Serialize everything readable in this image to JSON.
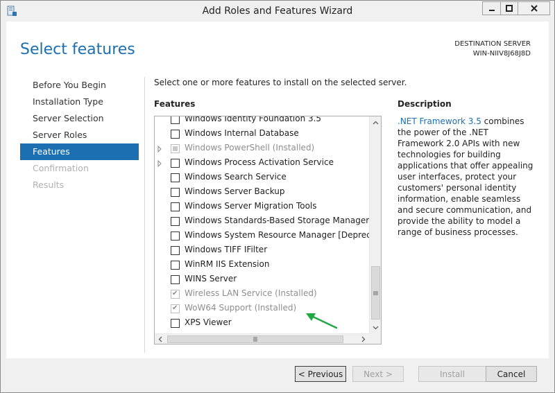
{
  "window": {
    "title": "Add Roles and Features Wizard"
  },
  "header": {
    "page_title": "Select features",
    "destination_label": "DESTINATION SERVER",
    "destination_server": "WIN-NIIV8J68J8D"
  },
  "nav": {
    "items": [
      {
        "label": "Before You Begin",
        "state": "normal"
      },
      {
        "label": "Installation Type",
        "state": "normal"
      },
      {
        "label": "Server Selection",
        "state": "normal"
      },
      {
        "label": "Server Roles",
        "state": "normal"
      },
      {
        "label": "Features",
        "state": "active"
      },
      {
        "label": "Confirmation",
        "state": "disabled"
      },
      {
        "label": "Results",
        "state": "disabled"
      }
    ]
  },
  "main": {
    "intro": "Select one or more features to install on the selected server.",
    "features_label": "Features",
    "features": [
      {
        "label": "Windows Identity Foundation 3.5",
        "checked": false,
        "disabled": false,
        "expandable": false
      },
      {
        "label": "Windows Internal Database",
        "checked": false,
        "disabled": false,
        "expandable": false
      },
      {
        "label": "Windows PowerShell (Installed)",
        "checked": "partial",
        "disabled": true,
        "expandable": true
      },
      {
        "label": "Windows Process Activation Service",
        "checked": false,
        "disabled": false,
        "expandable": true
      },
      {
        "label": "Windows Search Service",
        "checked": false,
        "disabled": false,
        "expandable": false
      },
      {
        "label": "Windows Server Backup",
        "checked": false,
        "disabled": false,
        "expandable": false
      },
      {
        "label": "Windows Server Migration Tools",
        "checked": false,
        "disabled": false,
        "expandable": false
      },
      {
        "label": "Windows Standards-Based Storage Management",
        "checked": false,
        "disabled": false,
        "expandable": false
      },
      {
        "label": "Windows System Resource Manager [Deprecated]",
        "checked": false,
        "disabled": false,
        "expandable": false
      },
      {
        "label": "Windows TIFF IFilter",
        "checked": false,
        "disabled": false,
        "expandable": false
      },
      {
        "label": "WinRM IIS Extension",
        "checked": false,
        "disabled": false,
        "expandable": false
      },
      {
        "label": "WINS Server",
        "checked": false,
        "disabled": false,
        "expandable": false
      },
      {
        "label": "Wireless LAN Service (Installed)",
        "checked": true,
        "disabled": true,
        "expandable": false
      },
      {
        "label": "WoW64 Support (Installed)",
        "checked": true,
        "disabled": true,
        "expandable": false
      },
      {
        "label": "XPS Viewer",
        "checked": false,
        "disabled": false,
        "expandable": false
      }
    ]
  },
  "description": {
    "label": "Description",
    "link_text": ".NET Framework 3.5",
    "text": " combines the power of the .NET Framework 2.0 APIs with new technologies for building applications that offer appealing user interfaces, protect your customers' personal identity information, enable seamless and secure communication, and provide the ability to model a range of business processes."
  },
  "buttons": {
    "previous": "< Previous",
    "next": "Next >",
    "install": "Install",
    "cancel": "Cancel"
  },
  "colors": {
    "accent": "#1c6fb0",
    "annotation_arrow": "#22a745"
  }
}
